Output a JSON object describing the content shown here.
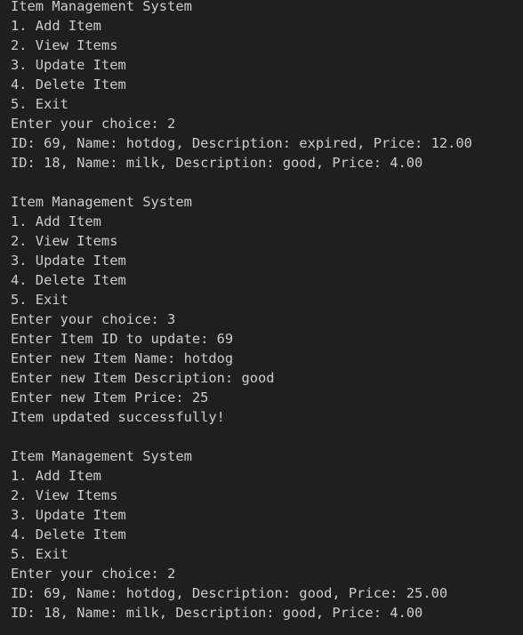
{
  "terminal": {
    "lines": [
      "Item Management System",
      "1. Add Item",
      "2. View Items",
      "3. Update Item",
      "4. Delete Item",
      "5. Exit",
      "Enter your choice: 2",
      "ID: 69, Name: hotdog, Description: expired, Price: 12.00",
      "ID: 18, Name: milk, Description: good, Price: 4.00",
      "",
      "Item Management System",
      "1. Add Item",
      "2. View Items",
      "3. Update Item",
      "4. Delete Item",
      "5. Exit",
      "Enter your choice: 3",
      "Enter Item ID to update: 69",
      "Enter new Item Name: hotdog",
      "Enter new Item Description: good",
      "Enter new Item Price: 25",
      "Item updated successfully!",
      "",
      "Item Management System",
      "1. Add Item",
      "2. View Items",
      "3. Update Item",
      "4. Delete Item",
      "5. Exit",
      "Enter your choice: 2",
      "ID: 69, Name: hotdog, Description: good, Price: 25.00",
      "ID: 18, Name: milk, Description: good, Price: 4.00"
    ]
  }
}
